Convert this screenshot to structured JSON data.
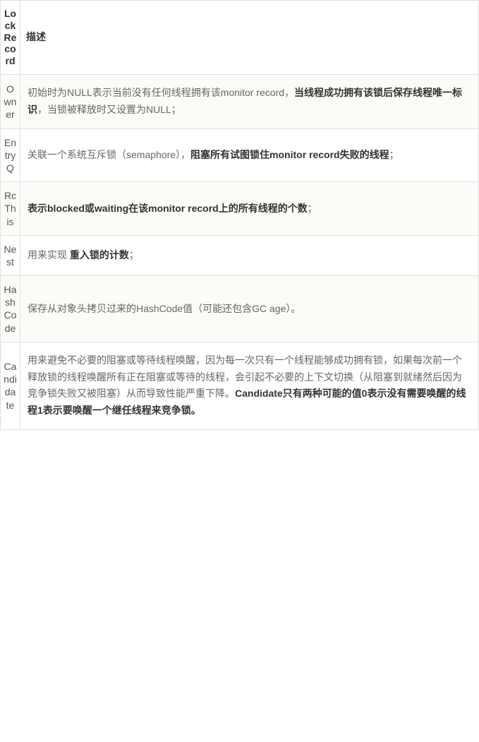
{
  "table": {
    "header": {
      "col1": "LockRecord",
      "col2": "描述"
    },
    "rows": [
      {
        "name": "Owner",
        "desc_pre": "初始时为NULL表示当前没有任何线程拥有该monitor record，",
        "desc_bold": "当线程成功拥有该锁后保存线程唯一标识",
        "desc_post": "，当锁被释放时又设置为NULL；"
      },
      {
        "name": "EntryQ",
        "desc_pre": "关联一个系统互斥锁（semaphore），",
        "desc_bold": "阻塞所有试图锁住monitor record失败的线程",
        "desc_post": "；"
      },
      {
        "name": "RcThis",
        "desc_pre": "",
        "desc_bold": "表示blocked或waiting在该monitor record上的所有线程的个数",
        "desc_post": "；"
      },
      {
        "name": "Nest",
        "desc_pre": "用来实现 ",
        "desc_bold": "重入锁的计数",
        "desc_post": "；"
      },
      {
        "name": "HashCode",
        "desc_pre": "保存从对象头拷贝过来的HashCode值（可能还包含GC age）。",
        "desc_bold": "",
        "desc_post": ""
      },
      {
        "name": "Candidate",
        "desc_pre": "用来避免不必要的阻塞或等待线程唤醒，因为每一次只有一个线程能够成功拥有锁，如果每次前一个释放锁的线程唤醒所有正在阻塞或等待的线程，会引起不必要的上下文切换（从阻塞到就绪然后因为竞争锁失败又被阻塞）从而导致性能严重下降。",
        "desc_bold": "Candidate只有两种可能的值0表示没有需要唤醒的线程1表示要唤醒一个继任线程来竞争锁。",
        "desc_post": ""
      }
    ]
  }
}
